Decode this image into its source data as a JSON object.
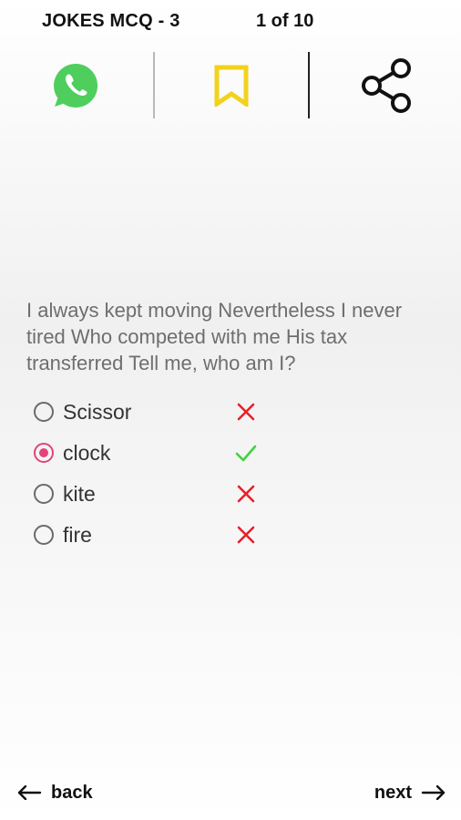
{
  "header": {
    "title": "JOKES MCQ - 3",
    "counter": "1 of 10"
  },
  "toolbar": {
    "icons": [
      "whatsapp-icon",
      "bookmark-icon",
      "share-icon"
    ]
  },
  "colors": {
    "whatsapp": "#4fce5d",
    "bookmark": "#f2d21c",
    "selected": "#e0457b",
    "correct": "#3ed43e",
    "wrong": "#e8202a",
    "question_text": "#6e6e6e"
  },
  "question": {
    "text": "I always kept moving Nevertheless I never tired Who competed with me His tax transferred Tell me, who am I?"
  },
  "options": [
    {
      "label": "Scissor",
      "selected": false,
      "result": "wrong"
    },
    {
      "label": "clock",
      "selected": true,
      "result": "correct"
    },
    {
      "label": "kite",
      "selected": false,
      "result": "wrong"
    },
    {
      "label": "fire",
      "selected": false,
      "result": "wrong"
    }
  ],
  "nav": {
    "back_label": "back",
    "next_label": "next"
  }
}
